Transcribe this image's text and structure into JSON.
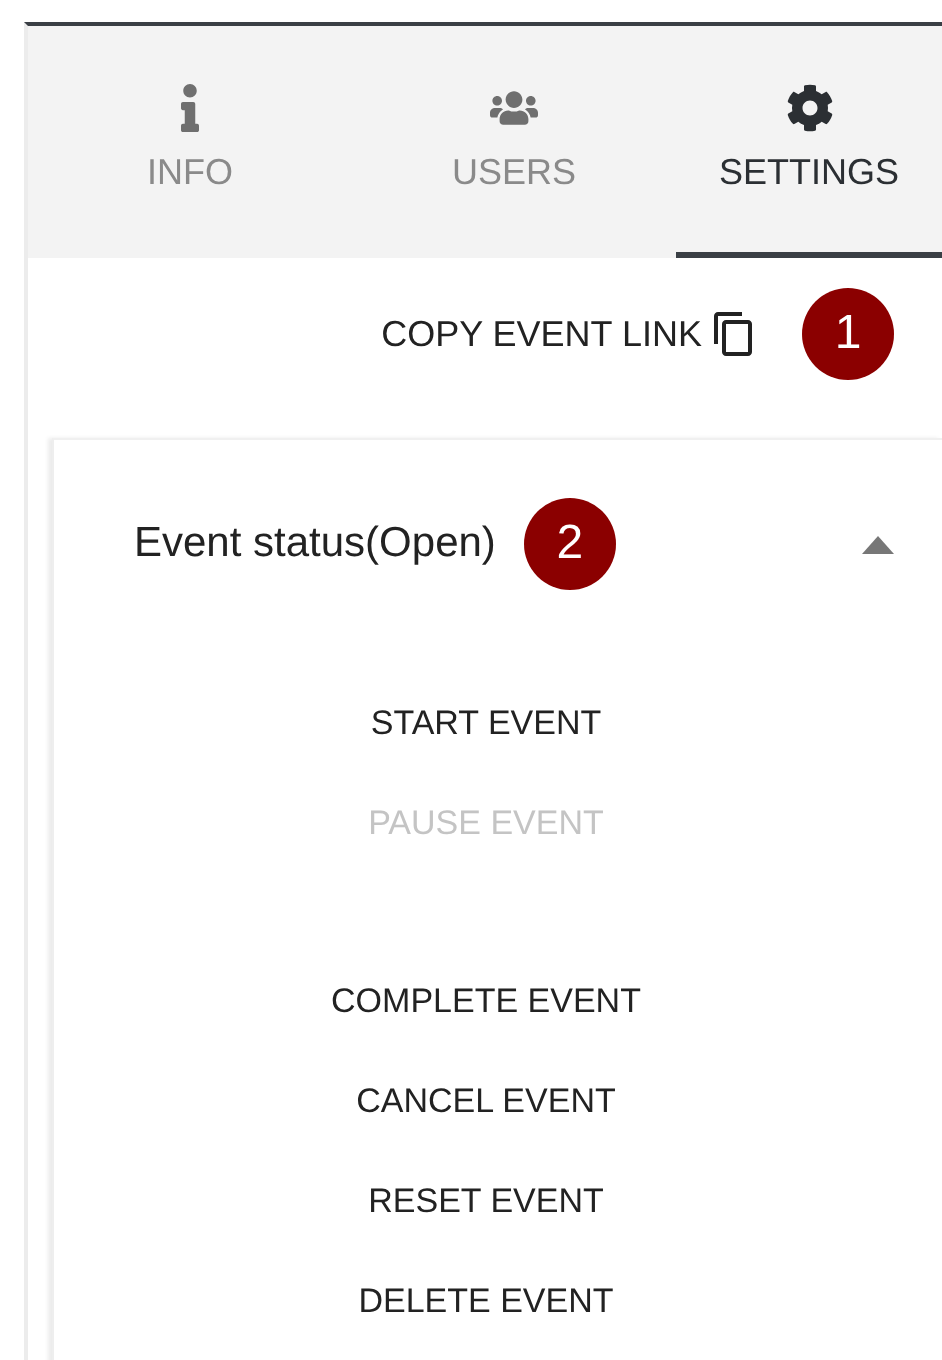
{
  "tabs": [
    {
      "label": "INFO",
      "selected": false
    },
    {
      "label": "USERS",
      "selected": false
    },
    {
      "label": "SETTINGS",
      "selected": true
    }
  ],
  "copy_link": {
    "label": "COPY EVENT LINK",
    "marker": "1"
  },
  "status_panel": {
    "title": "Event status(Open)",
    "marker": "2",
    "expanded": true,
    "action_groups": [
      [
        {
          "label": "START EVENT",
          "disabled": false
        },
        {
          "label": "PAUSE EVENT",
          "disabled": true
        }
      ],
      [
        {
          "label": "COMPLETE EVENT",
          "disabled": false
        },
        {
          "label": "CANCEL EVENT",
          "disabled": false
        },
        {
          "label": "RESET EVENT",
          "disabled": false
        },
        {
          "label": "DELETE EVENT",
          "disabled": false
        }
      ]
    ]
  }
}
